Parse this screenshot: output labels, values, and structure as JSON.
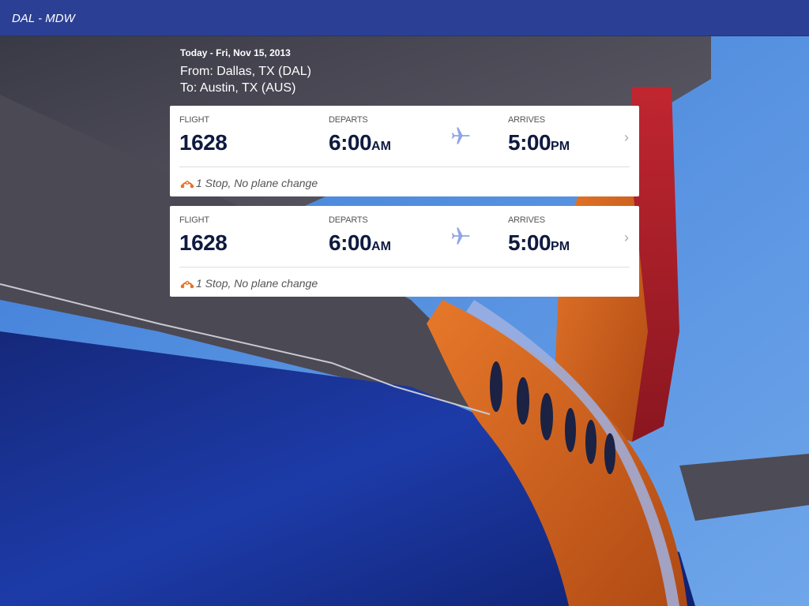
{
  "header": {
    "title": "DAL - MDW"
  },
  "trip": {
    "date": "Today - Fri, Nov 15, 2013",
    "from": "From: Dallas, TX (DAL)",
    "to": "To: Austin, TX (AUS)"
  },
  "flights": [
    {
      "flight_label": "FLIGHT",
      "flight_number": "1628",
      "departs_label": "DEPARTS",
      "departs_time": "6:00",
      "departs_ampm": "AM",
      "arrives_label": "ARRIVES",
      "arrives_time": "5:00",
      "arrives_ampm": "PM",
      "stops": "1 Stop, No plane change"
    },
    {
      "flight_label": "FLIGHT",
      "flight_number": "1628",
      "departs_label": "DEPARTS",
      "departs_time": "6:00",
      "departs_ampm": "AM",
      "arrives_label": "ARRIVES",
      "arrives_time": "5:00",
      "arrives_ampm": "PM",
      "stops": "1 Stop, No plane change"
    }
  ],
  "icons": {
    "plane": "airplane-icon",
    "chevron": "chevron-right-icon",
    "stop": "stop-route-icon"
  },
  "colors": {
    "header_bg": "#2b3f94",
    "text_dark": "#0f1a40",
    "plane_icon": "#8ea3e8",
    "stop_icon": "#e8702a"
  }
}
